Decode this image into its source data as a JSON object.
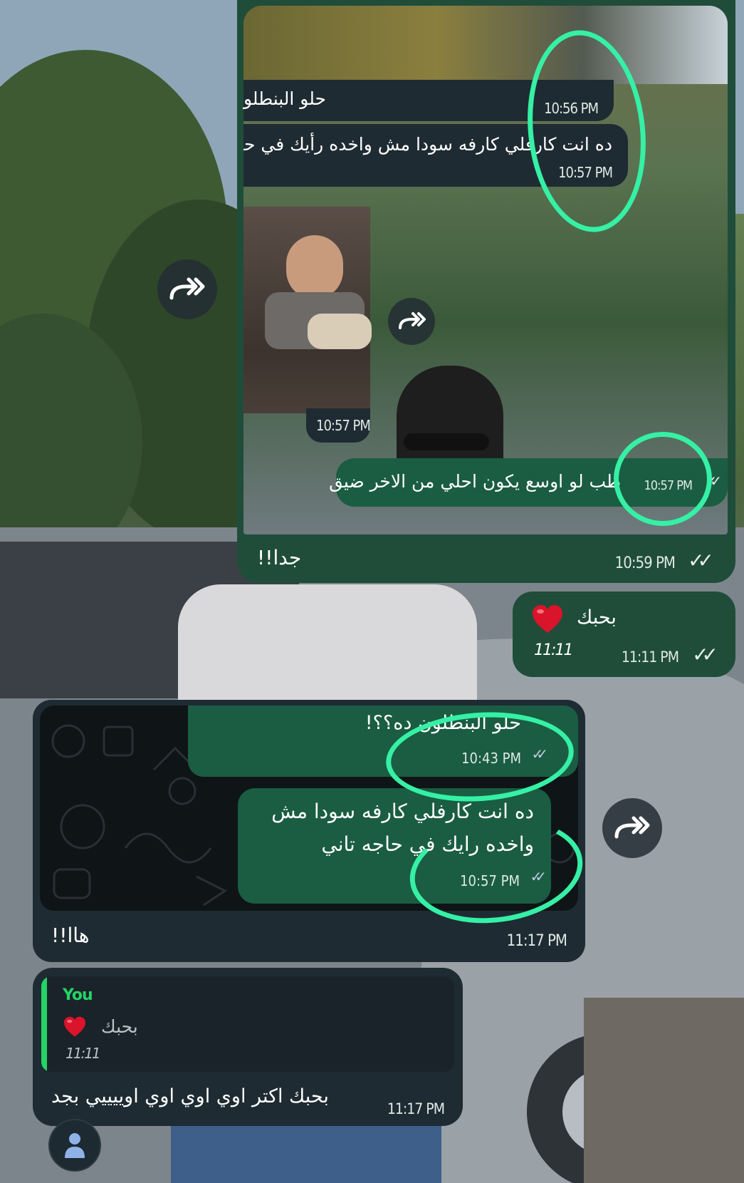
{
  "colors": {
    "bubble_dark": "#1f2b33",
    "bubble_green": "#1a5d43",
    "frame_green": "#1f4d3a",
    "highlight_marker": "#35f0a5",
    "heart": "#d9142b",
    "quote_bar": "#25d366"
  },
  "screenshot1": {
    "messages": [
      {
        "text": "حلو البنطلو",
        "time": "10:56 PM"
      },
      {
        "text": "ده انت كارفلي كارفه سودا مش واخده رأيك في حا",
        "time": "10:57 PM"
      },
      {
        "text": "",
        "time": "10:57 PM",
        "attachment": "photo"
      },
      {
        "text": "طب لو اوسع يكون احلي من الاخر ضيق",
        "time": "10:57 PM"
      }
    ],
    "forward_icon": "double-forward-arrow-icon"
  },
  "reply_1": {
    "text": "جدا!!",
    "time": "10:59 PM",
    "status_icon": "double-check-icon"
  },
  "reply_2": {
    "text": "بحبك",
    "emoji": "heart-icon",
    "sub": "11:11",
    "time": "11:11 PM",
    "status_icon": "double-check-icon"
  },
  "screenshot2": {
    "messages": [
      {
        "text": "حلو البنطلون ده؟؟!",
        "time": "10:43 PM"
      },
      {
        "line1": "ده انت كارفلي كارفه سودا مش",
        "line2": "واخده رايك في حاجه تاني",
        "time": "10:57 PM"
      }
    ]
  },
  "reply_3": {
    "text": "هاا!!",
    "time": "11:17 PM"
  },
  "reply_4": {
    "quote_author": "You",
    "quote_text": "بحبك",
    "quote_sub": "11:11",
    "text": "بحبك اكتر اوي اوي اوي اوييييي بجد",
    "time": "11:17 PM"
  },
  "avatar_icon": "user-avatar-icon"
}
